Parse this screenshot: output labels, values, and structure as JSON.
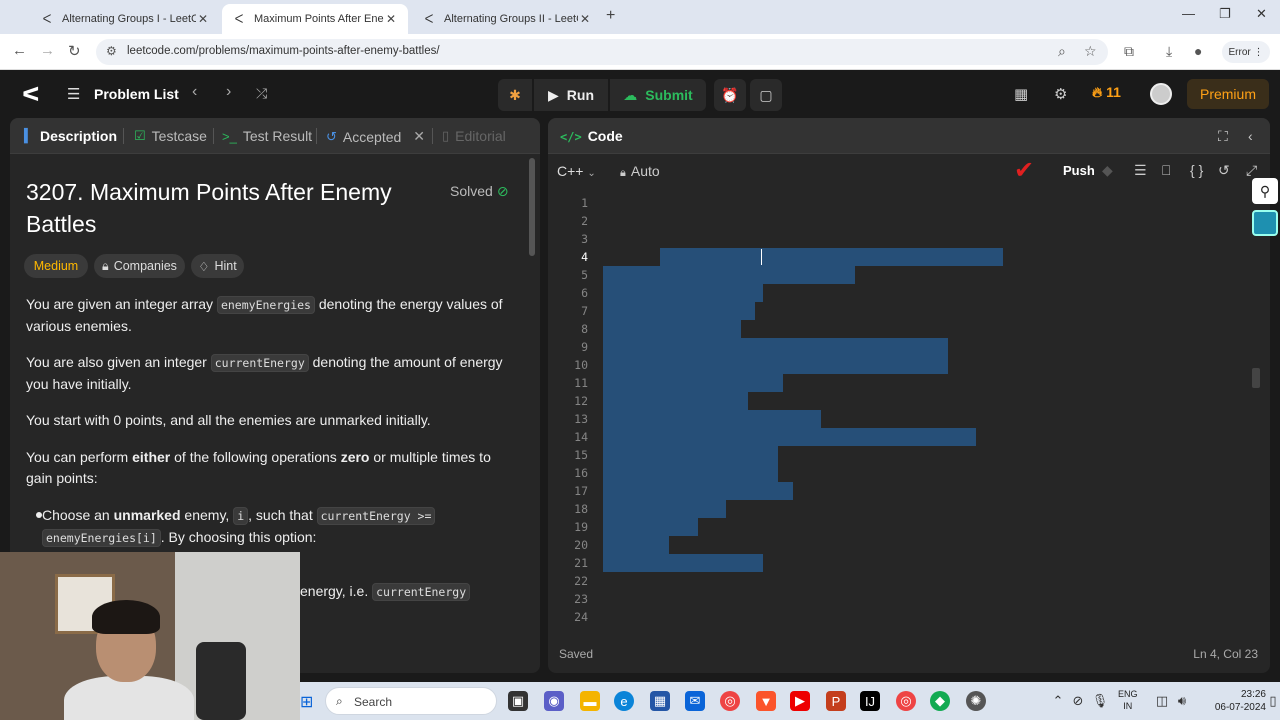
{
  "browser": {
    "tabs": [
      {
        "title": "Alternating Groups I - LeetCode",
        "active": false
      },
      {
        "title": "Maximum Points After Enemy Battles",
        "active": true
      },
      {
        "title": "Alternating Groups II - LeetCode",
        "active": false
      }
    ],
    "url": "leetcode.com/problems/maximum-points-after-enemy-battles/",
    "error_label": "Error"
  },
  "nav": {
    "problem_list": "Problem List",
    "run": "Run",
    "submit": "Submit",
    "streak": "11",
    "premium": "Premium"
  },
  "left": {
    "tabs": [
      "Description",
      "Testcase",
      "Test Result",
      "Accepted",
      "Editorial"
    ],
    "title": "3207. Maximum Points After Enemy Battles",
    "solved": "Solved",
    "difficulty": "Medium",
    "companies": "Companies",
    "hint": "Hint",
    "p1_a": "You are given an integer array ",
    "p1_code": "enemyEnergies",
    "p1_b": " denoting the energy values of various enemies.",
    "p2_a": "You are also given an integer ",
    "p2_code": "currentEnergy",
    "p2_b": " denoting the amount of energy you have initially.",
    "p3": "You start with 0 points, and all the enemies are unmarked initially.",
    "p4_a": "You can perform ",
    "p4_b1": "either",
    "p4_c": " of the following operations ",
    "p4_b2": "zero",
    "p4_d": " or multiple times to gain points:",
    "b1_a": "Choose an ",
    "b1_b": "unmarked",
    "b1_c": " enemy, ",
    "b1_code1": "i",
    "b1_d": ", such that ",
    "b1_code2": "currentEnergy >=",
    "b1_code3": "enemyEnergies[i]",
    "b1_e": ". By choosing this option:",
    "partial_a": "energy, i.e. ",
    "partial_code": "currentEnergy"
  },
  "code": {
    "title": "Code",
    "language": "C++",
    "mode": "Auto",
    "push": "Push",
    "status": "Saved",
    "position": "Ln 4, Col 23",
    "line_numbers": [
      "1",
      "2",
      "3",
      "4",
      "5",
      "6",
      "7",
      "8",
      "9",
      "10",
      "11",
      "12",
      "13",
      "14",
      "15",
      "16",
      "17",
      "18",
      "19",
      "20",
      "21",
      "22",
      "23",
      "24"
    ]
  },
  "taskbar": {
    "search": "Search",
    "lang": "ENG",
    "region": "IN",
    "time": "23:26",
    "date": "06-07-2024"
  },
  "colors": {
    "accent_green": "#2cbb5d",
    "medium": "#ffb800",
    "premium": "#ffa116",
    "selection": "#264f78"
  }
}
